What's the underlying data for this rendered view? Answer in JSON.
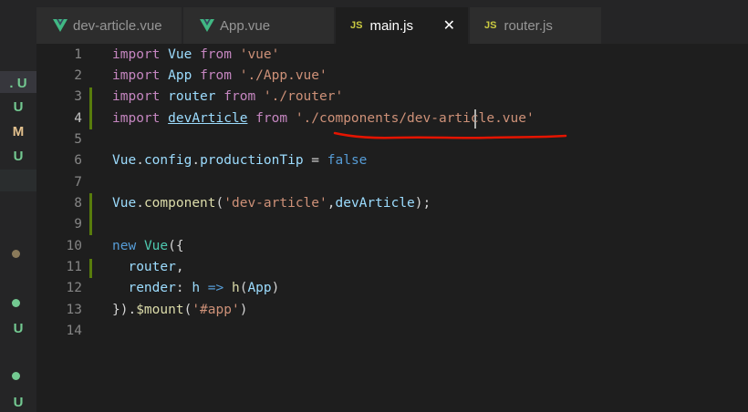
{
  "tabs": [
    {
      "label": "dev-article.vue",
      "icon": "vue-icon",
      "active": false
    },
    {
      "label": "App.vue",
      "icon": "vue-icon",
      "active": false
    },
    {
      "label": "main.js",
      "icon": "js-icon",
      "active": true
    },
    {
      "label": "router.js",
      "icon": "js-icon",
      "active": false
    }
  ],
  "js_icon_text": "JS",
  "close_glyph": "✕",
  "explorer_status": [
    {
      "kind": "letter",
      "text": ". U",
      "color": "#73c991"
    },
    {
      "kind": "letter",
      "text": "U",
      "color": "#73c991"
    },
    {
      "kind": "letter",
      "text": "M",
      "color": "#e2c08d"
    },
    {
      "kind": "letter",
      "text": "U",
      "color": "#73c991"
    },
    {
      "kind": "dot",
      "color": "#8a7a5a"
    },
    {
      "kind": "dot",
      "color": "#73c991"
    },
    {
      "kind": "letter",
      "text": "U",
      "color": "#73c991"
    },
    {
      "kind": "dot",
      "color": "#73c991"
    },
    {
      "kind": "letter",
      "text": "U",
      "color": "#73c991"
    }
  ],
  "line_numbers": [
    "1",
    "2",
    "3",
    "4",
    "5",
    "6",
    "7",
    "8",
    "9",
    "10",
    "11",
    "12",
    "13",
    "14"
  ],
  "current_line": "4",
  "code": {
    "l1": {
      "import": "import",
      "name": "Vue",
      "from": "from",
      "src": "'vue'"
    },
    "l2": {
      "import": "import",
      "name": "App",
      "from": "from",
      "src": "'./App.vue'"
    },
    "l3": {
      "import": "import",
      "name": "router",
      "from": "from",
      "src": "'./router'"
    },
    "l4": {
      "import": "import",
      "name": "devArticle",
      "from": "from",
      "src": "'./components/dev-article.vue'"
    },
    "l6": {
      "obj": "Vue",
      "dot1": ".",
      "prop1": "config",
      "dot2": ".",
      "prop2": "productionTip",
      "eq": " = ",
      "val": "false"
    },
    "l8": {
      "obj": "Vue",
      "dot": ".",
      "method": "component",
      "open": "(",
      "arg1": "'dev-article'",
      "comma": ",",
      "arg2": "devArticle",
      "close": ");"
    },
    "l10": {
      "new": "new",
      "cls": "Vue",
      "open": "({"
    },
    "l11": {
      "indent": "  ",
      "key": "router",
      "comma": ","
    },
    "l12": {
      "indent": "  ",
      "key": "render",
      "colon": ": ",
      "param": "h",
      "arrow": " => ",
      "fn": "h",
      "open": "(",
      "arg": "App",
      "close": ")"
    },
    "l13": {
      "open": "}).",
      "method": "$mount",
      "paren": "(",
      "arg": "'#app'",
      "close": ")"
    }
  },
  "colors": {
    "background": "#1e1e1e",
    "keyword": "#569cd6",
    "control": "#c586c0",
    "string": "#ce9178",
    "variable": "#9cdcfe",
    "function": "#dcdcaa",
    "added_line_marker": "#587c0c",
    "annotation_red": "#e51400",
    "vue_green": "#41b883",
    "js_yellow": "#cbcb41"
  }
}
